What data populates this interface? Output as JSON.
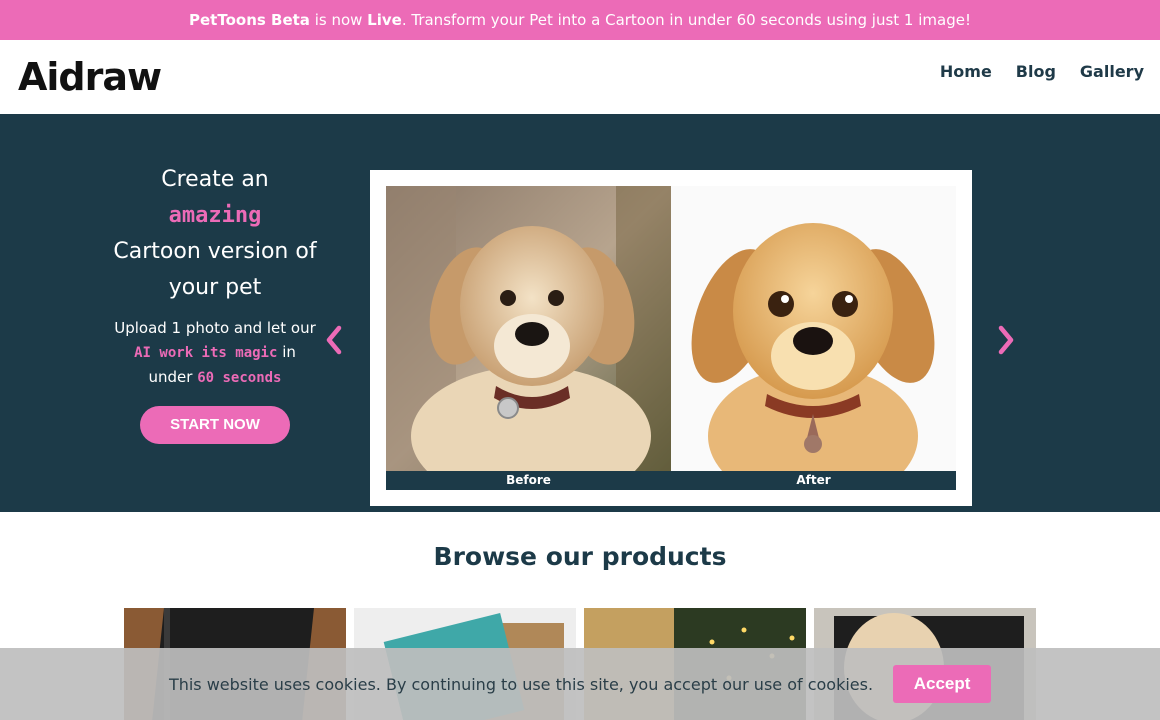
{
  "banner": {
    "brand": "PetToons Beta",
    "mid": " is now ",
    "live": "Live",
    "rest": ". Transform your Pet into a Cartoon in under 60 seconds using just 1 image!"
  },
  "header": {
    "logo_text": "Aidraw",
    "nav": [
      "Home",
      "Blog",
      "Gallery"
    ]
  },
  "hero": {
    "title_line1": "Create an",
    "title_accent": "amazing",
    "title_line2": "Cartoon version of your pet",
    "sub_line1": "Upload 1 photo and let our ",
    "sub_accent1": "AI work its magic",
    "sub_line2": " in under ",
    "sub_accent2": "60 seconds",
    "cta": "START NOW",
    "captions": {
      "before": "Before",
      "after": "After"
    }
  },
  "products": {
    "title": "Browse our products"
  },
  "cookie": {
    "text": "This website uses cookies. By continuing to use this site, you accept our use of cookies.",
    "accept": "Accept"
  },
  "colors": {
    "accent": "#ec6bb7",
    "hero_bg": "#1c3a48"
  }
}
